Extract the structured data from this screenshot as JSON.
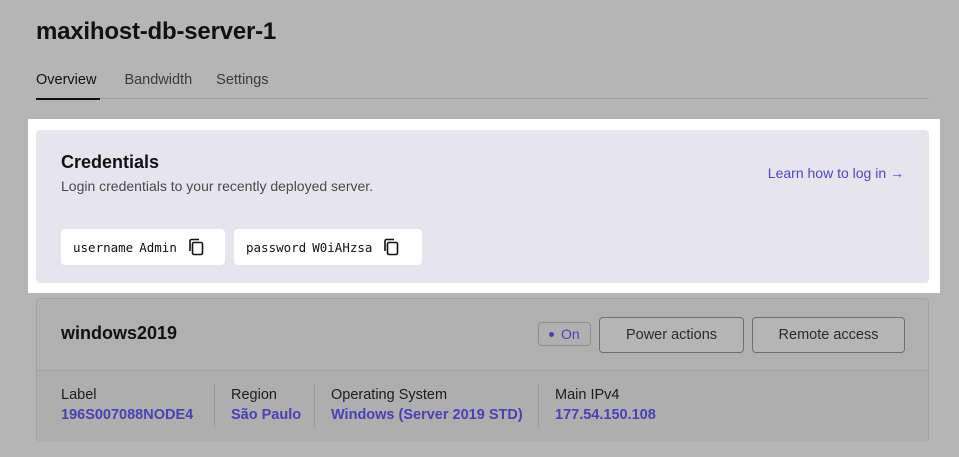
{
  "page": {
    "title": "maxihost-db-server-1"
  },
  "tabs": [
    {
      "label": "Overview",
      "active": true
    },
    {
      "label": "Bandwidth",
      "active": false
    },
    {
      "label": "Settings",
      "active": false
    }
  ],
  "credentials": {
    "title": "Credentials",
    "subtitle": "Login credentials to your recently deployed server.",
    "link": "Learn how to log in →",
    "username_key": "username",
    "username_value": "Admin",
    "password_key": "password",
    "password_value": "W0iAHzsa"
  },
  "server": {
    "name": "windows2019",
    "status": "On",
    "power_actions_label": "Power actions",
    "remote_access_label": "Remote access",
    "details": [
      {
        "label": "Label",
        "value": "196S007088NODE4"
      },
      {
        "label": "Region",
        "value": "São Paulo"
      },
      {
        "label": "Operating System",
        "value": "Windows (Server 2019 STD)"
      },
      {
        "label": "Main IPv4",
        "value": "177.54.150.108"
      }
    ]
  },
  "colors": {
    "accent": "#4f46c6",
    "background": "#b5b5b5",
    "card_highlight": "#e6e5ee"
  },
  "icons": [
    "copy-icon",
    "status-dot"
  ]
}
